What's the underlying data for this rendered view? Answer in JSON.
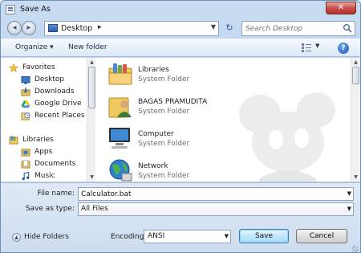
{
  "window": {
    "title": "Save As",
    "close_label": "✕"
  },
  "address": {
    "location": "Desktop",
    "search_placeholder": "Search Desktop"
  },
  "toolbar": {
    "organize_label": "Organize ▾",
    "new_folder_label": "New folder",
    "help_label": "?"
  },
  "nav": {
    "favorites_label": "Favorites",
    "favorites": [
      {
        "label": "Desktop",
        "icon": "desktop-icon"
      },
      {
        "label": "Downloads",
        "icon": "downloads-icon"
      },
      {
        "label": "Google Drive",
        "icon": "google-drive-icon"
      },
      {
        "label": "Recent Places",
        "icon": "recent-places-icon"
      }
    ],
    "libraries_label": "Libraries",
    "libraries": [
      {
        "label": "Apps",
        "icon": "apps-icon"
      },
      {
        "label": "Documents",
        "icon": "documents-icon"
      },
      {
        "label": "Music",
        "icon": "music-icon"
      }
    ]
  },
  "files": [
    {
      "name": "Libraries",
      "type": "System Folder",
      "icon": "libraries-folder-icon"
    },
    {
      "name": "BAGAS PRAMUDITA",
      "type": "System Folder",
      "icon": "user-folder-icon"
    },
    {
      "name": "Computer",
      "type": "System Folder",
      "icon": "computer-icon"
    },
    {
      "name": "Network",
      "type": "System Folder",
      "icon": "network-icon"
    }
  ],
  "form": {
    "file_name_label": "File name:",
    "file_name_value": "Calculator.bat",
    "save_as_type_label": "Save as type:",
    "save_as_type_value": "All Files",
    "encoding_label": "Encoding:",
    "encoding_value": "ANSI"
  },
  "buttons": {
    "hide_folders": "Hide Folders",
    "save": "Save",
    "cancel": "Cancel"
  }
}
